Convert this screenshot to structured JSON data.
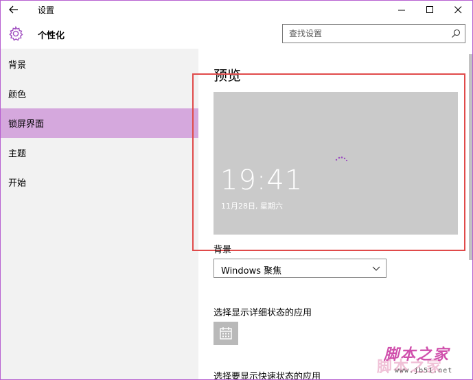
{
  "window": {
    "title": "设置"
  },
  "header": {
    "title": "个性化",
    "search_placeholder": "查找设置"
  },
  "sidebar": {
    "items": [
      {
        "label": "背景"
      },
      {
        "label": "颜色"
      },
      {
        "label": "锁屏界面",
        "selected": true
      },
      {
        "label": "主题"
      },
      {
        "label": "开始"
      }
    ]
  },
  "main": {
    "preview_title": "预览",
    "preview_time": "19:41",
    "preview_date": "11月28日, 星期六",
    "background_label": "背景",
    "background_value": "Windows 聚焦",
    "detail_status_label": "选择显示详细状态的应用",
    "quick_status_label": "选择要显示快速状态的应用"
  },
  "watermark": {
    "text": "脚本之家",
    "sub": "www.jb51.net"
  },
  "colors": {
    "accent": "#b65fd0",
    "selected_nav": "#d5a8dd",
    "highlight": "#e04a4a",
    "preview_bg": "#cacaca"
  },
  "icons": [
    "back-arrow-icon",
    "minimize-icon",
    "maximize-icon",
    "close-icon",
    "gear-icon",
    "search-icon",
    "chevron-down-icon",
    "calendar-icon",
    "loading-icon"
  ]
}
